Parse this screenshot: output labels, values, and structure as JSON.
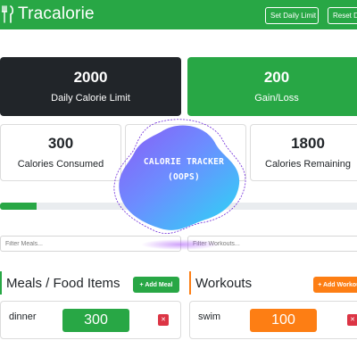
{
  "navbar": {
    "brand": "Tracalorie",
    "brand_icon": "fork-knife-icon",
    "set_limit_label": "Set Daily Limit",
    "reset_label": "Reset Day",
    "color": "#28a745"
  },
  "stats": {
    "daily_limit": {
      "value": "2000",
      "label": "Daily Calorie Limit"
    },
    "gain_loss": {
      "value": "200",
      "label": "Gain/Loss"
    },
    "consumed": {
      "value": "300",
      "label": "Calories Consumed"
    },
    "remaining": {
      "value": "1800",
      "label": "Calories Remaining"
    }
  },
  "progress": {
    "fraction": 0.1
  },
  "filters": {
    "meals_placeholder": "Filter Meals...",
    "workouts_placeholder": "Filter Workouts..."
  },
  "meals": {
    "title": "Meals / Food Items",
    "add_label": "+ Add Meal",
    "items": [
      {
        "name": "dinner",
        "calories": "300"
      }
    ]
  },
  "workouts": {
    "title": "Workouts",
    "add_label": "+ Add Workout",
    "items": [
      {
        "name": "swim",
        "calories": "100"
      }
    ]
  },
  "overlay": {
    "line1": "CALORIE TRACKER",
    "line2": "(OOPS)"
  },
  "colors": {
    "primary": "#28a745",
    "dark": "#212529",
    "workout": "#fd7e14",
    "danger": "#dc3545"
  },
  "icons": {
    "delete": "x-icon"
  }
}
